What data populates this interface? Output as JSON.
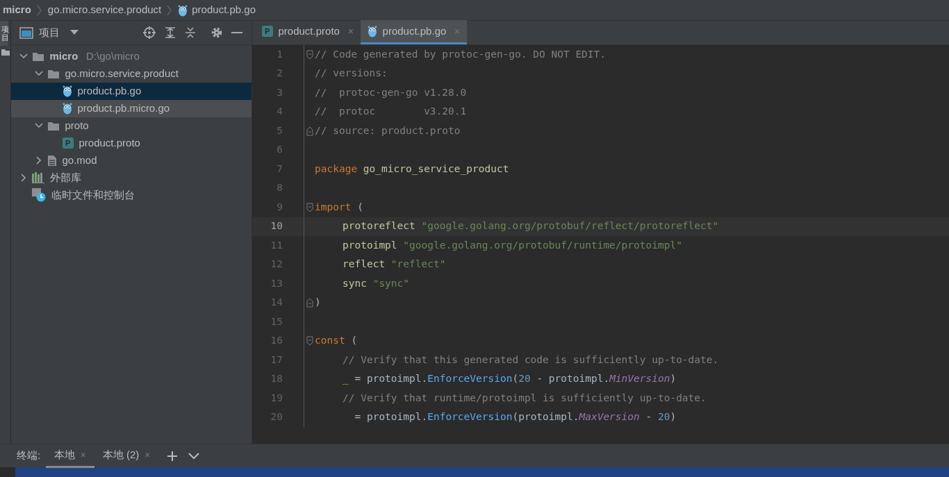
{
  "breadcrumb": [
    {
      "label": "micro",
      "kind": "root"
    },
    {
      "label": "go.micro.service.product",
      "kind": "folder"
    },
    {
      "label": "product.pb.go",
      "kind": "gofile"
    }
  ],
  "side_strip": {
    "label": "项目"
  },
  "project_panel": {
    "title": "项目"
  },
  "tree": [
    {
      "label": "micro",
      "path": "D:\\go\\micro",
      "kind": "folder",
      "expanded": true,
      "selected": false,
      "children": [
        {
          "label": "go.micro.service.product",
          "kind": "folder",
          "expanded": true,
          "selected": false,
          "children": [
            {
              "label": "product.pb.go",
              "kind": "gofile",
              "selected": true
            },
            {
              "label": "product.pb.micro.go",
              "kind": "gofile",
              "selected": false,
              "hovered": true
            }
          ]
        },
        {
          "label": "proto",
          "kind": "folder",
          "expanded": true,
          "selected": false,
          "children": [
            {
              "label": "product.proto",
              "kind": "proto",
              "icon_letter": "P",
              "selected": false
            }
          ]
        },
        {
          "label": "go.mod",
          "kind": "mod",
          "expanded": false,
          "selected": false
        }
      ]
    },
    {
      "label": "外部库",
      "kind": "library",
      "expanded": false,
      "selected": false
    },
    {
      "label": "临时文件和控制台",
      "kind": "scratch",
      "selected": false
    }
  ],
  "tabs": [
    {
      "label": "product.proto",
      "kind": "proto",
      "icon_letter": "P",
      "close": "×",
      "selected": false
    },
    {
      "label": "product.pb.go",
      "kind": "gofile",
      "close": "×",
      "selected": true
    }
  ],
  "code_lines": [
    {
      "number": "1",
      "fold_start": true,
      "tokens": [
        {
          "t": "// Code generated by protoc-gen-go. DO NOT EDIT.",
          "kind": "comment"
        }
      ]
    },
    {
      "number": "2",
      "tokens": [
        {
          "t": "// versions:",
          "kind": "comment"
        }
      ]
    },
    {
      "number": "3",
      "tokens": [
        {
          "t": "//  protoc-gen-go v1.28.0",
          "kind": "comment"
        }
      ]
    },
    {
      "number": "4",
      "tokens": [
        {
          "t": "//  protoc        v3.20.1",
          "kind": "comment"
        }
      ]
    },
    {
      "number": "5",
      "fold_end": true,
      "tokens": [
        {
          "t": "// source: product.proto",
          "kind": "comment"
        }
      ]
    },
    {
      "number": "6"
    },
    {
      "number": "7",
      "tokens": [
        {
          "t": "package",
          "kind": "keyword"
        },
        {
          "t": "go_micro_service_product",
          "kind": "ident"
        }
      ]
    },
    {
      "number": "8"
    },
    {
      "number": "9",
      "fold_start": true,
      "tokens": [
        {
          "t": "import",
          "kind": "keyword"
        },
        {
          "t": "(",
          "kind": "plain"
        }
      ]
    },
    {
      "number": "10",
      "current": true,
      "indented": true,
      "tokens": [
        {
          "t": "protoreflect",
          "kind": "ident"
        },
        {
          "t": "\"google.golang.org/protobuf/reflect/protoreflect\"",
          "kind": "string"
        }
      ]
    },
    {
      "number": "11",
      "indented": true,
      "tokens": [
        {
          "t": "protoimpl",
          "kind": "ident"
        },
        {
          "t": "\"google.golang.org/protobuf/runtime/protoimpl\"",
          "kind": "string"
        }
      ]
    },
    {
      "number": "12",
      "indented": true,
      "tokens": [
        {
          "t": "reflect",
          "kind": "ident"
        },
        {
          "t": "\"reflect\"",
          "kind": "string"
        }
      ]
    },
    {
      "number": "13",
      "indented": true,
      "tokens": [
        {
          "t": "sync",
          "kind": "ident"
        },
        {
          "t": "\"sync\"",
          "kind": "string"
        }
      ]
    },
    {
      "number": "14",
      "fold_end": true,
      "tokens": [
        {
          "t": ")",
          "kind": "plain"
        }
      ]
    },
    {
      "number": "15"
    },
    {
      "number": "16",
      "fold_start": true,
      "tokens": [
        {
          "t": "const",
          "kind": "keyword"
        },
        {
          "t": "(",
          "kind": "plain"
        }
      ]
    },
    {
      "number": "17",
      "indented": true,
      "tokens": [
        {
          "t": "// Verify that this generated code is sufficiently up-to-date.",
          "kind": "comment"
        }
      ]
    },
    {
      "number": "18",
      "indented": true,
      "tokens": [
        {
          "t": "_",
          "kind": "blank"
        },
        {
          "t": "= protoimpl.",
          "kind": "plain"
        },
        {
          "t": "EnforceVersion",
          "kind": "func"
        },
        {
          "t": "(",
          "kind": "plain"
        },
        {
          "t": "20",
          "kind": "number"
        },
        {
          "t": " - protoimpl.",
          "kind": "plain"
        },
        {
          "t": "MinVersion",
          "kind": "field"
        },
        {
          "t": ")",
          "kind": "plain"
        }
      ]
    },
    {
      "number": "19",
      "indented": true,
      "tokens": [
        {
          "t": "// Verify that runtime/protoimpl is sufficiently up-to-date.",
          "kind": "comment"
        }
      ]
    },
    {
      "number": "20",
      "indented": true,
      "tokens": [
        {
          "t": "  = protoimpl.",
          "kind": "plain"
        },
        {
          "t": "EnforceVersion",
          "kind": "func"
        },
        {
          "t": "(protoimpl.",
          "kind": "plain"
        },
        {
          "t": "MaxVersion",
          "kind": "field"
        },
        {
          "t": " - ",
          "kind": "plain"
        },
        {
          "t": "20",
          "kind": "number"
        },
        {
          "t": ")",
          "kind": "plain"
        }
      ]
    }
  ],
  "terminal": {
    "title": "终端:",
    "tabs": [
      {
        "label": "本地",
        "close": "×",
        "selected": true
      },
      {
        "label": "本地 (2)",
        "close": "×",
        "selected": false
      }
    ]
  }
}
